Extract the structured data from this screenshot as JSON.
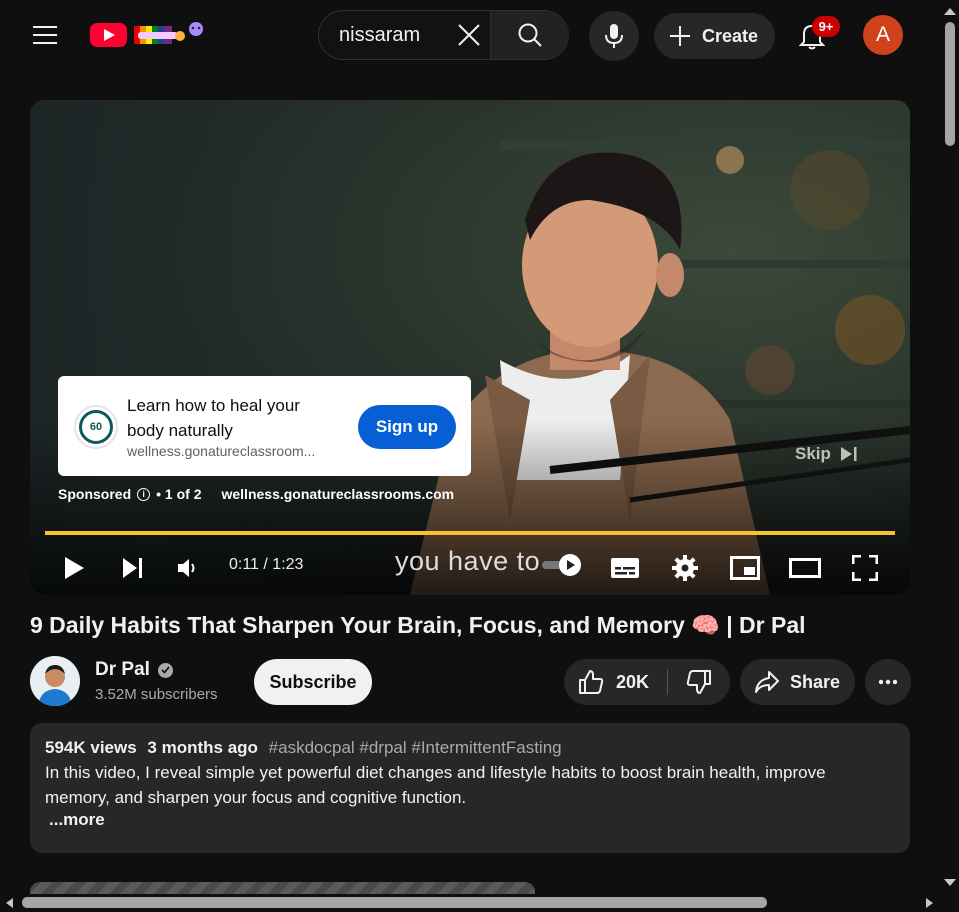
{
  "topbar": {
    "search_value": "nissaram",
    "create_label": "Create",
    "notifications_badge": "9+",
    "avatar_letter": "A"
  },
  "player": {
    "ad": {
      "title": "Learn how to heal your body naturally",
      "url": "wellness.gonatureclassroom...",
      "cta": "Sign up",
      "logo_text": "60"
    },
    "sponsored_label": "Sponsored",
    "ad_counter": "• 1 of 2",
    "sponsor_site": "wellness.gonatureclassrooms.com",
    "skip_label": "Skip",
    "time": "0:11 / 1:23",
    "progress": 1.0,
    "caption": "you have to"
  },
  "video": {
    "title": "9 Daily Habits That Sharpen Your Brain, Focus, and Memory 🧠 | Dr Pal",
    "channel_name": "Dr Pal",
    "subscribers": "3.52M subscribers",
    "subscribe_label": "Subscribe",
    "likes": "20K",
    "share_label": "Share"
  },
  "description": {
    "views": "594K views",
    "ago": "3 months ago",
    "tags": "#askdocpal #drpal #IntermittentFasting",
    "body": "In this video, I reveal simple yet powerful diet changes and lifestyle habits to boost brain health, improve memory, and sharpen your focus and cognitive function.",
    "more_label": "...more"
  },
  "colors": {
    "background": "#0f0f0f",
    "brand_red": "#ff0033",
    "progress_yellow": "#fbc02d",
    "signup_blue": "#065fd4",
    "avatar_orange": "#d0421b"
  }
}
